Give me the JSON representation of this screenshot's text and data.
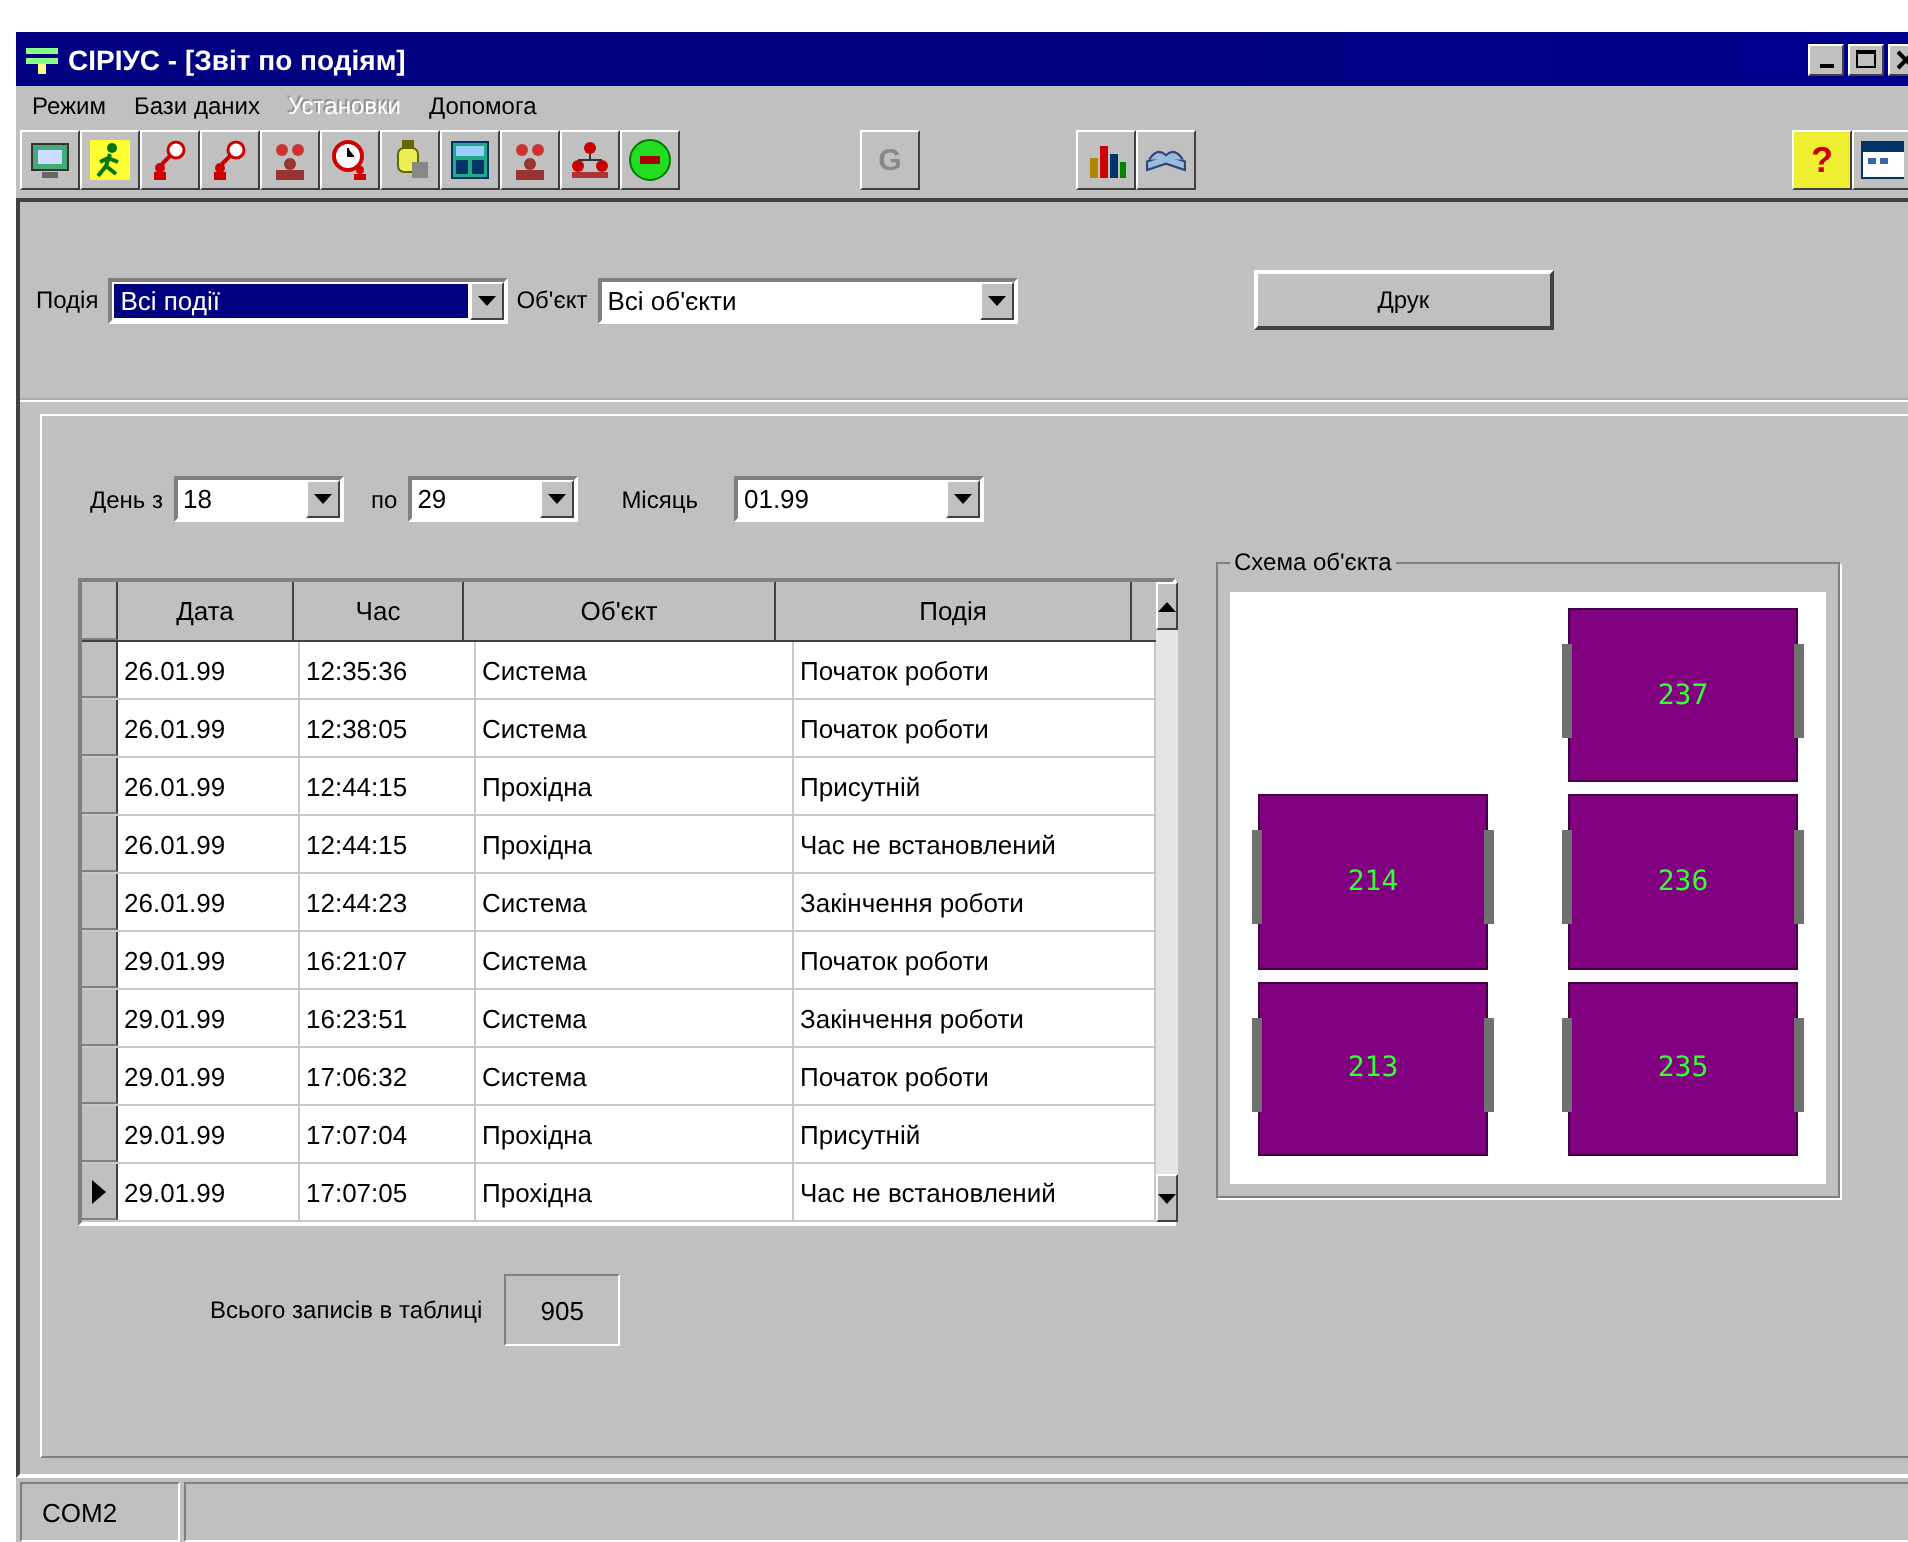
{
  "window": {
    "title": "СІРІУС - [Звіт по подіям]"
  },
  "menu": [
    {
      "label": "Режим",
      "disabled": false
    },
    {
      "label": "Бази даних",
      "disabled": false
    },
    {
      "label": "Установки",
      "disabled": true
    },
    {
      "label": "Допомога",
      "disabled": false
    }
  ],
  "toolbar": {
    "shield_letter": "G",
    "help_glyph": "?"
  },
  "filters": {
    "event_label": "Подія",
    "event_value": "Всі події",
    "object_label": "Об'єкт",
    "object_value": "Всі об'єкти",
    "print_button": "Друк"
  },
  "period": {
    "from_label": "День з",
    "from_value": "18",
    "to_label": "по",
    "to_value": "29",
    "month_label": "Місяць",
    "month_value": "01.99"
  },
  "table": {
    "columns": [
      "Дата",
      "Час",
      "Об'єкт",
      "Подія"
    ],
    "rows": [
      {
        "cells": [
          "26.01.99",
          "12:35:36",
          "Система",
          "Початок роботи"
        ],
        "selected": false
      },
      {
        "cells": [
          "26.01.99",
          "12:38:05",
          "Система",
          "Початок роботи"
        ],
        "selected": false
      },
      {
        "cells": [
          "26.01.99",
          "12:44:15",
          "Прохідна",
          "Присутній"
        ],
        "selected": false
      },
      {
        "cells": [
          "26.01.99",
          "12:44:15",
          "Прохідна",
          "Час не встановлений"
        ],
        "selected": false
      },
      {
        "cells": [
          "26.01.99",
          "12:44:23",
          "Система",
          "Закінчення роботи"
        ],
        "selected": false
      },
      {
        "cells": [
          "29.01.99",
          "16:21:07",
          "Система",
          "Початок роботи"
        ],
        "selected": false
      },
      {
        "cells": [
          "29.01.99",
          "16:23:51",
          "Система",
          "Закінчення роботи"
        ],
        "selected": false
      },
      {
        "cells": [
          "29.01.99",
          "17:06:32",
          "Система",
          "Початок роботи"
        ],
        "selected": false
      },
      {
        "cells": [
          "29.01.99",
          "17:07:04",
          "Прохідна",
          "Присутній"
        ],
        "selected": false
      },
      {
        "cells": [
          "29.01.99",
          "17:07:05",
          "Прохідна",
          "Час не встановлений"
        ],
        "selected": true
      }
    ]
  },
  "scheme": {
    "title": "Схема об'єкта",
    "rooms": [
      {
        "label": "237"
      },
      {
        "label": "214"
      },
      {
        "label": "236"
      },
      {
        "label": "213"
      },
      {
        "label": "235"
      }
    ]
  },
  "total": {
    "label": "Всього записів в таблиці",
    "value": "905"
  },
  "status_bar": {
    "port": "COM2"
  }
}
